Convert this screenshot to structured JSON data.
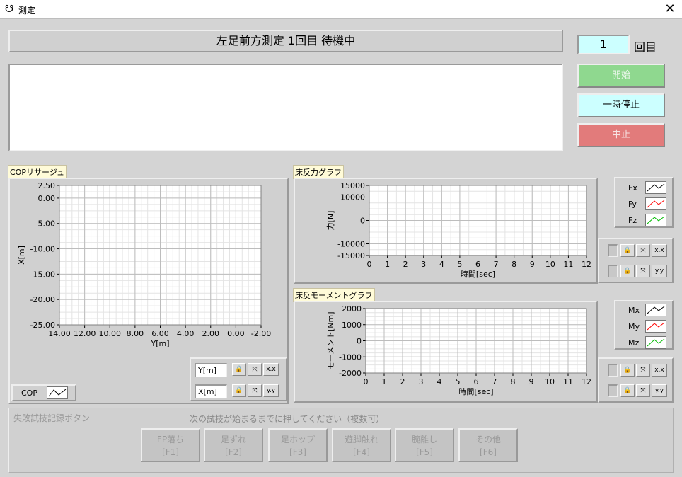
{
  "window": {
    "title": "測定",
    "close": "✕",
    "icon": "app-icon"
  },
  "status_text": "左足前方測定 1回目 待機中",
  "counter": {
    "value": "1",
    "label": "回目"
  },
  "buttons": {
    "start": "開始",
    "pause": "一時停止",
    "stop": "中止"
  },
  "colors": {
    "start": "#8fd88f",
    "pause": "#ccffff",
    "stop": "#e27b7b",
    "plot_bg": "#ffffff",
    "grid_major": "#bdbdbd",
    "grid_minor": "#e4e4e4",
    "fx": "#000000",
    "fy": "#ff0000",
    "fz": "#00bb00"
  },
  "cop_panel": {
    "label": "COPリサージュ",
    "legend": "COP",
    "axis_buttons": [
      {
        "label": "Y[m]"
      },
      {
        "label": "X[m]"
      }
    ]
  },
  "force_panel": {
    "label": "床反力グラフ",
    "legend": [
      "Fx",
      "Fy",
      "Fz"
    ]
  },
  "moment_panel": {
    "label": "床反モーメントグラフ",
    "legend": [
      "Mx",
      "My",
      "Mz"
    ]
  },
  "chart_data": [
    {
      "type": "scatter",
      "title": "COPリサージュ",
      "xlabel": "Y[m]",
      "ylabel": "X[m]",
      "xlim": [
        14.0,
        -2.0
      ],
      "ylim": [
        -25.0,
        2.5
      ],
      "xticks": [
        "14.00",
        "12.00",
        "10.00",
        "8.00",
        "6.00",
        "4.00",
        "2.00",
        "0.00",
        "-2.00"
      ],
      "yticks": [
        "2.50",
        "0.00",
        "-5.00",
        "-10.00",
        "-15.00",
        "-20.00",
        "-25.00"
      ],
      "series": [
        {
          "name": "COP",
          "x": [],
          "y": []
        }
      ],
      "grid": true
    },
    {
      "type": "line",
      "title": "床反力グラフ",
      "xlabel": "時間[sec]",
      "ylabel": "力[N]",
      "xlim": [
        0,
        12
      ],
      "ylim": [
        -15000,
        15000
      ],
      "xticks": [
        "0",
        "1",
        "2",
        "3",
        "4",
        "5",
        "6",
        "7",
        "8",
        "9",
        "10",
        "11",
        "12"
      ],
      "yticks": [
        "15000",
        "10000",
        "0",
        "-10000",
        "-15000"
      ],
      "series": [
        {
          "name": "Fx",
          "values": []
        },
        {
          "name": "Fy",
          "values": []
        },
        {
          "name": "Fz",
          "values": []
        }
      ],
      "grid": true,
      "legend": "top-right"
    },
    {
      "type": "line",
      "title": "床反モーメントグラフ",
      "xlabel": "時間[sec]",
      "ylabel": "モーメント[Nm]",
      "xlim": [
        0,
        12
      ],
      "ylim": [
        -2000,
        2000
      ],
      "xticks": [
        "0",
        "1",
        "2",
        "3",
        "4",
        "5",
        "6",
        "7",
        "8",
        "9",
        "10",
        "11",
        "12"
      ],
      "yticks": [
        "2000",
        "1000",
        "0",
        "-1000",
        "-2000"
      ],
      "series": [
        {
          "name": "Mx",
          "values": []
        },
        {
          "name": "My",
          "values": []
        },
        {
          "name": "Mz",
          "values": []
        }
      ],
      "grid": true,
      "legend": "top-right"
    }
  ],
  "footer": {
    "title": "失敗試技記録ボタン",
    "hint": "次の試技が始まるまでに押してください（複数可）",
    "buttons": [
      {
        "label": "FP落ち",
        "key": "[F1]"
      },
      {
        "label": "足ずれ",
        "key": "[F2]"
      },
      {
        "label": "足ホップ",
        "key": "[F3]"
      },
      {
        "label": "遊脚触れ",
        "key": "[F4]"
      },
      {
        "label": "腕離し",
        "key": "[F5]"
      },
      {
        "label": "その他",
        "key": "[F6]"
      }
    ]
  }
}
